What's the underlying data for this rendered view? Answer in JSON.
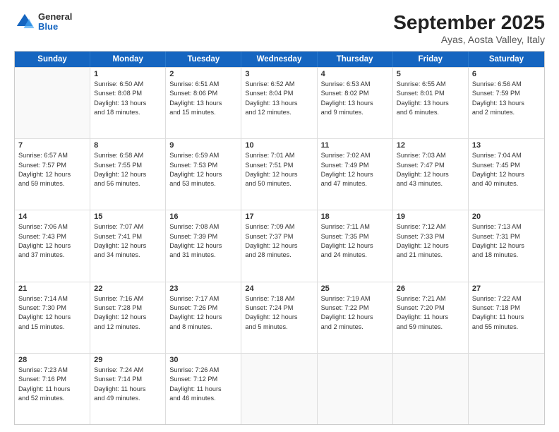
{
  "logo": {
    "general": "General",
    "blue": "Blue"
  },
  "title": "September 2025",
  "subtitle": "Ayas, Aosta Valley, Italy",
  "header_days": [
    "Sunday",
    "Monday",
    "Tuesday",
    "Wednesday",
    "Thursday",
    "Friday",
    "Saturday"
  ],
  "weeks": [
    [
      {
        "day": "",
        "info": ""
      },
      {
        "day": "1",
        "info": "Sunrise: 6:50 AM\nSunset: 8:08 PM\nDaylight: 13 hours\nand 18 minutes."
      },
      {
        "day": "2",
        "info": "Sunrise: 6:51 AM\nSunset: 8:06 PM\nDaylight: 13 hours\nand 15 minutes."
      },
      {
        "day": "3",
        "info": "Sunrise: 6:52 AM\nSunset: 8:04 PM\nDaylight: 13 hours\nand 12 minutes."
      },
      {
        "day": "4",
        "info": "Sunrise: 6:53 AM\nSunset: 8:02 PM\nDaylight: 13 hours\nand 9 minutes."
      },
      {
        "day": "5",
        "info": "Sunrise: 6:55 AM\nSunset: 8:01 PM\nDaylight: 13 hours\nand 6 minutes."
      },
      {
        "day": "6",
        "info": "Sunrise: 6:56 AM\nSunset: 7:59 PM\nDaylight: 13 hours\nand 2 minutes."
      }
    ],
    [
      {
        "day": "7",
        "info": "Sunrise: 6:57 AM\nSunset: 7:57 PM\nDaylight: 12 hours\nand 59 minutes."
      },
      {
        "day": "8",
        "info": "Sunrise: 6:58 AM\nSunset: 7:55 PM\nDaylight: 12 hours\nand 56 minutes."
      },
      {
        "day": "9",
        "info": "Sunrise: 6:59 AM\nSunset: 7:53 PM\nDaylight: 12 hours\nand 53 minutes."
      },
      {
        "day": "10",
        "info": "Sunrise: 7:01 AM\nSunset: 7:51 PM\nDaylight: 12 hours\nand 50 minutes."
      },
      {
        "day": "11",
        "info": "Sunrise: 7:02 AM\nSunset: 7:49 PM\nDaylight: 12 hours\nand 47 minutes."
      },
      {
        "day": "12",
        "info": "Sunrise: 7:03 AM\nSunset: 7:47 PM\nDaylight: 12 hours\nand 43 minutes."
      },
      {
        "day": "13",
        "info": "Sunrise: 7:04 AM\nSunset: 7:45 PM\nDaylight: 12 hours\nand 40 minutes."
      }
    ],
    [
      {
        "day": "14",
        "info": "Sunrise: 7:06 AM\nSunset: 7:43 PM\nDaylight: 12 hours\nand 37 minutes."
      },
      {
        "day": "15",
        "info": "Sunrise: 7:07 AM\nSunset: 7:41 PM\nDaylight: 12 hours\nand 34 minutes."
      },
      {
        "day": "16",
        "info": "Sunrise: 7:08 AM\nSunset: 7:39 PM\nDaylight: 12 hours\nand 31 minutes."
      },
      {
        "day": "17",
        "info": "Sunrise: 7:09 AM\nSunset: 7:37 PM\nDaylight: 12 hours\nand 28 minutes."
      },
      {
        "day": "18",
        "info": "Sunrise: 7:11 AM\nSunset: 7:35 PM\nDaylight: 12 hours\nand 24 minutes."
      },
      {
        "day": "19",
        "info": "Sunrise: 7:12 AM\nSunset: 7:33 PM\nDaylight: 12 hours\nand 21 minutes."
      },
      {
        "day": "20",
        "info": "Sunrise: 7:13 AM\nSunset: 7:31 PM\nDaylight: 12 hours\nand 18 minutes."
      }
    ],
    [
      {
        "day": "21",
        "info": "Sunrise: 7:14 AM\nSunset: 7:30 PM\nDaylight: 12 hours\nand 15 minutes."
      },
      {
        "day": "22",
        "info": "Sunrise: 7:16 AM\nSunset: 7:28 PM\nDaylight: 12 hours\nand 12 minutes."
      },
      {
        "day": "23",
        "info": "Sunrise: 7:17 AM\nSunset: 7:26 PM\nDaylight: 12 hours\nand 8 minutes."
      },
      {
        "day": "24",
        "info": "Sunrise: 7:18 AM\nSunset: 7:24 PM\nDaylight: 12 hours\nand 5 minutes."
      },
      {
        "day": "25",
        "info": "Sunrise: 7:19 AM\nSunset: 7:22 PM\nDaylight: 12 hours\nand 2 minutes."
      },
      {
        "day": "26",
        "info": "Sunrise: 7:21 AM\nSunset: 7:20 PM\nDaylight: 11 hours\nand 59 minutes."
      },
      {
        "day": "27",
        "info": "Sunrise: 7:22 AM\nSunset: 7:18 PM\nDaylight: 11 hours\nand 55 minutes."
      }
    ],
    [
      {
        "day": "28",
        "info": "Sunrise: 7:23 AM\nSunset: 7:16 PM\nDaylight: 11 hours\nand 52 minutes."
      },
      {
        "day": "29",
        "info": "Sunrise: 7:24 AM\nSunset: 7:14 PM\nDaylight: 11 hours\nand 49 minutes."
      },
      {
        "day": "30",
        "info": "Sunrise: 7:26 AM\nSunset: 7:12 PM\nDaylight: 11 hours\nand 46 minutes."
      },
      {
        "day": "",
        "info": ""
      },
      {
        "day": "",
        "info": ""
      },
      {
        "day": "",
        "info": ""
      },
      {
        "day": "",
        "info": ""
      }
    ]
  ]
}
